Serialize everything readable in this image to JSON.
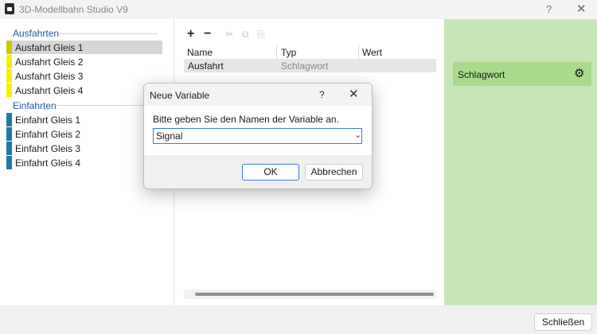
{
  "window": {
    "title": "3D-Modellbahn Studio V9",
    "help": "?",
    "close": "✕"
  },
  "sidebar": {
    "sections": [
      {
        "label": "Ausfahrten",
        "items": [
          {
            "label": "Ausfahrt Gleis 1",
            "selected": true,
            "color": "#c9c900"
          },
          {
            "label": "Ausfahrt Gleis 2",
            "selected": false,
            "color": "#f5f000"
          },
          {
            "label": "Ausfahrt Gleis 3",
            "selected": false,
            "color": "#f5f000"
          },
          {
            "label": "Ausfahrt Gleis 4",
            "selected": false,
            "color": "#f5f000"
          }
        ]
      },
      {
        "label": "Einfahrten",
        "items": [
          {
            "label": "Einfahrt Gleis 1",
            "selected": false,
            "color": "#1f78a8"
          },
          {
            "label": "Einfahrt Gleis 2",
            "selected": false,
            "color": "#1f78a8"
          },
          {
            "label": "Einfahrt Gleis 3",
            "selected": false,
            "color": "#1f78a8"
          },
          {
            "label": "Einfahrt Gleis 4",
            "selected": false,
            "color": "#1f78a8"
          }
        ]
      }
    ]
  },
  "toolbar": {
    "add": "+",
    "remove": "−",
    "cut": "✂",
    "copy": "⧉",
    "paste": "⎘"
  },
  "table": {
    "headers": [
      "Name",
      "Typ",
      "Wert"
    ],
    "rows": [
      {
        "name": "Ausfahrt",
        "type": "Schlagwort",
        "value": ""
      }
    ]
  },
  "right_panel": {
    "card_label": "Schlagwort",
    "gear_icon": "⚙"
  },
  "footer": {
    "close_button": "Schließen"
  },
  "dialog": {
    "title": "Neue Variable",
    "help": "?",
    "close": "✕",
    "prompt": "Bitte geben Sie den Namen der Variable an.",
    "input_value": "Signal",
    "dropdown_icon": "⌄",
    "ok_button": "OK",
    "cancel_button": "Abbrechen"
  },
  "colors": {
    "accent": "#3a7bd5",
    "panel_green": "#c7e6b5",
    "card_green": "#a9d98c"
  }
}
